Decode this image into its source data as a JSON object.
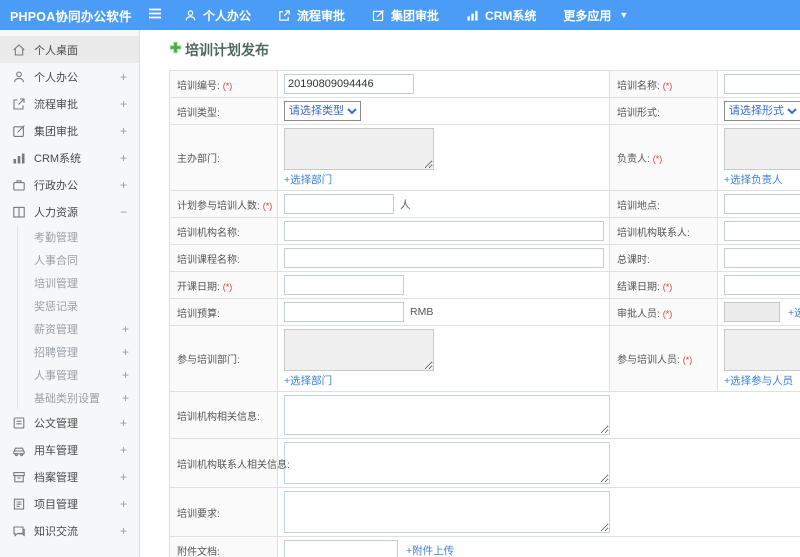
{
  "topbar": {
    "logo": "PHPOA协同办公软件",
    "nav": [
      {
        "label": "个人办公"
      },
      {
        "label": "流程审批"
      },
      {
        "label": "集团审批"
      },
      {
        "label": "CRM系统"
      },
      {
        "label": "更多应用"
      }
    ]
  },
  "sidebar": {
    "items": [
      {
        "label": "个人桌面"
      },
      {
        "label": "个人办公",
        "expand": "+"
      },
      {
        "label": "流程审批",
        "expand": "+"
      },
      {
        "label": "集团审批",
        "expand": "+"
      },
      {
        "label": "CRM系统",
        "expand": "+"
      },
      {
        "label": "行政办公",
        "expand": "+"
      },
      {
        "label": "人力资源",
        "expand": "−"
      },
      {
        "label": "公文管理",
        "expand": "+"
      },
      {
        "label": "用车管理",
        "expand": "+"
      },
      {
        "label": "档案管理",
        "expand": "+"
      },
      {
        "label": "项目管理",
        "expand": "+"
      },
      {
        "label": "知识交流",
        "expand": "+"
      }
    ],
    "hr_children": [
      {
        "label": "考勤管理"
      },
      {
        "label": "人事合同"
      },
      {
        "label": "培训管理"
      },
      {
        "label": "奖惩记录"
      },
      {
        "label": "薪资管理",
        "expand": "+"
      },
      {
        "label": "招聘管理",
        "expand": "+"
      },
      {
        "label": "人事管理",
        "expand": "+"
      },
      {
        "label": "基础类别设置",
        "expand": "+"
      }
    ]
  },
  "form": {
    "title": "培训计划发布",
    "req": "(*)",
    "fields": {
      "number": {
        "label": "培训编号:",
        "value": "20190809094446"
      },
      "name": {
        "label": "培训名称:"
      },
      "type": {
        "label": "培训类型:",
        "selected": "请选择类型"
      },
      "mode": {
        "label": "培训形式:",
        "selected": "请选择形式"
      },
      "host_dept": {
        "label": "主办部门:",
        "link": "+选择部门"
      },
      "leader": {
        "label": "负责人:",
        "link": "+选择负责人"
      },
      "planned_count": {
        "label": "计划参与培训人数:",
        "suffix": "人"
      },
      "location": {
        "label": "培训地点:"
      },
      "org_name": {
        "label": "培训机构名称:"
      },
      "org_contact": {
        "label": "培训机构联系人:"
      },
      "course_name": {
        "label": "培训课程名称:"
      },
      "total_hours": {
        "label": "总课时:"
      },
      "start_date": {
        "label": "开课日期:"
      },
      "end_date": {
        "label": "结课日期:"
      },
      "budget": {
        "label": "培训预算:",
        "suffix": "RMB"
      },
      "approver": {
        "label": "审批人员:",
        "link": "+选择审批人员"
      },
      "join_dept": {
        "label": "参与培训部门:",
        "link": "+选择部门"
      },
      "join_people": {
        "label": "参与培训人员:",
        "link": "+选择参与人员"
      },
      "org_info": {
        "label": "培训机构相关信息:"
      },
      "org_contact_info": {
        "label": "培训机构联系人相关信息:"
      },
      "requirements": {
        "label": "培训要求:"
      },
      "attachment": {
        "label": "附件文档:",
        "link": "+附件上传"
      }
    }
  }
}
